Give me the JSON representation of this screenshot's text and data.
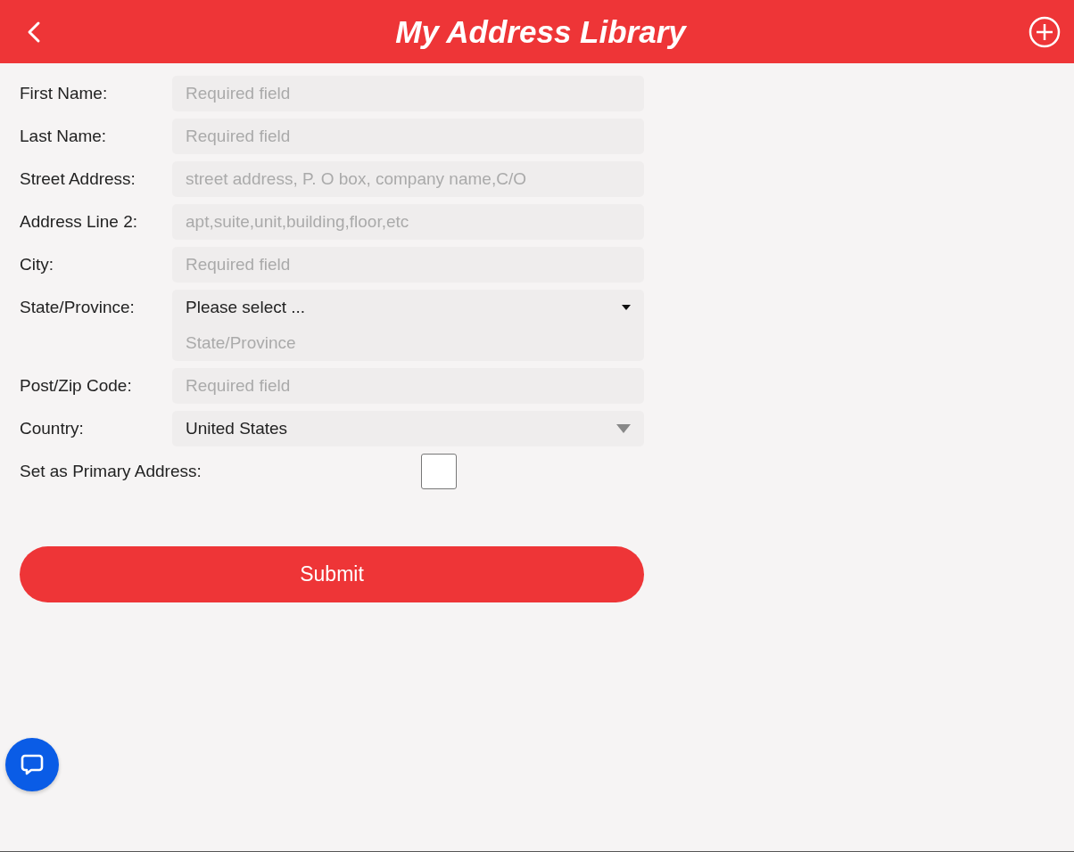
{
  "header": {
    "title": "My Address Library"
  },
  "form": {
    "fields": [
      {
        "label": "First Name:",
        "kind": "text",
        "placeholder": "Required field"
      },
      {
        "label": "Last Name:",
        "kind": "text",
        "placeholder": "Required field"
      },
      {
        "label": "Street Address:",
        "kind": "text",
        "placeholder": "street address, P. O box, company name,C/O"
      },
      {
        "label": "Address Line 2:",
        "kind": "text",
        "placeholder": "apt,suite,unit,building,floor,etc"
      },
      {
        "label": "City:",
        "kind": "text",
        "placeholder": "Required field"
      },
      {
        "label": "State/Province:",
        "kind": "select-combo",
        "value": "Please select ...",
        "placeholder": "State/Province"
      },
      {
        "label": "Post/Zip Code:",
        "kind": "text",
        "placeholder": "Required field"
      },
      {
        "label": "Country:",
        "kind": "select",
        "value": "United States"
      },
      {
        "label": "Set as Primary Address:",
        "kind": "checkbox",
        "checked": false
      }
    ],
    "submit": "Submit"
  }
}
